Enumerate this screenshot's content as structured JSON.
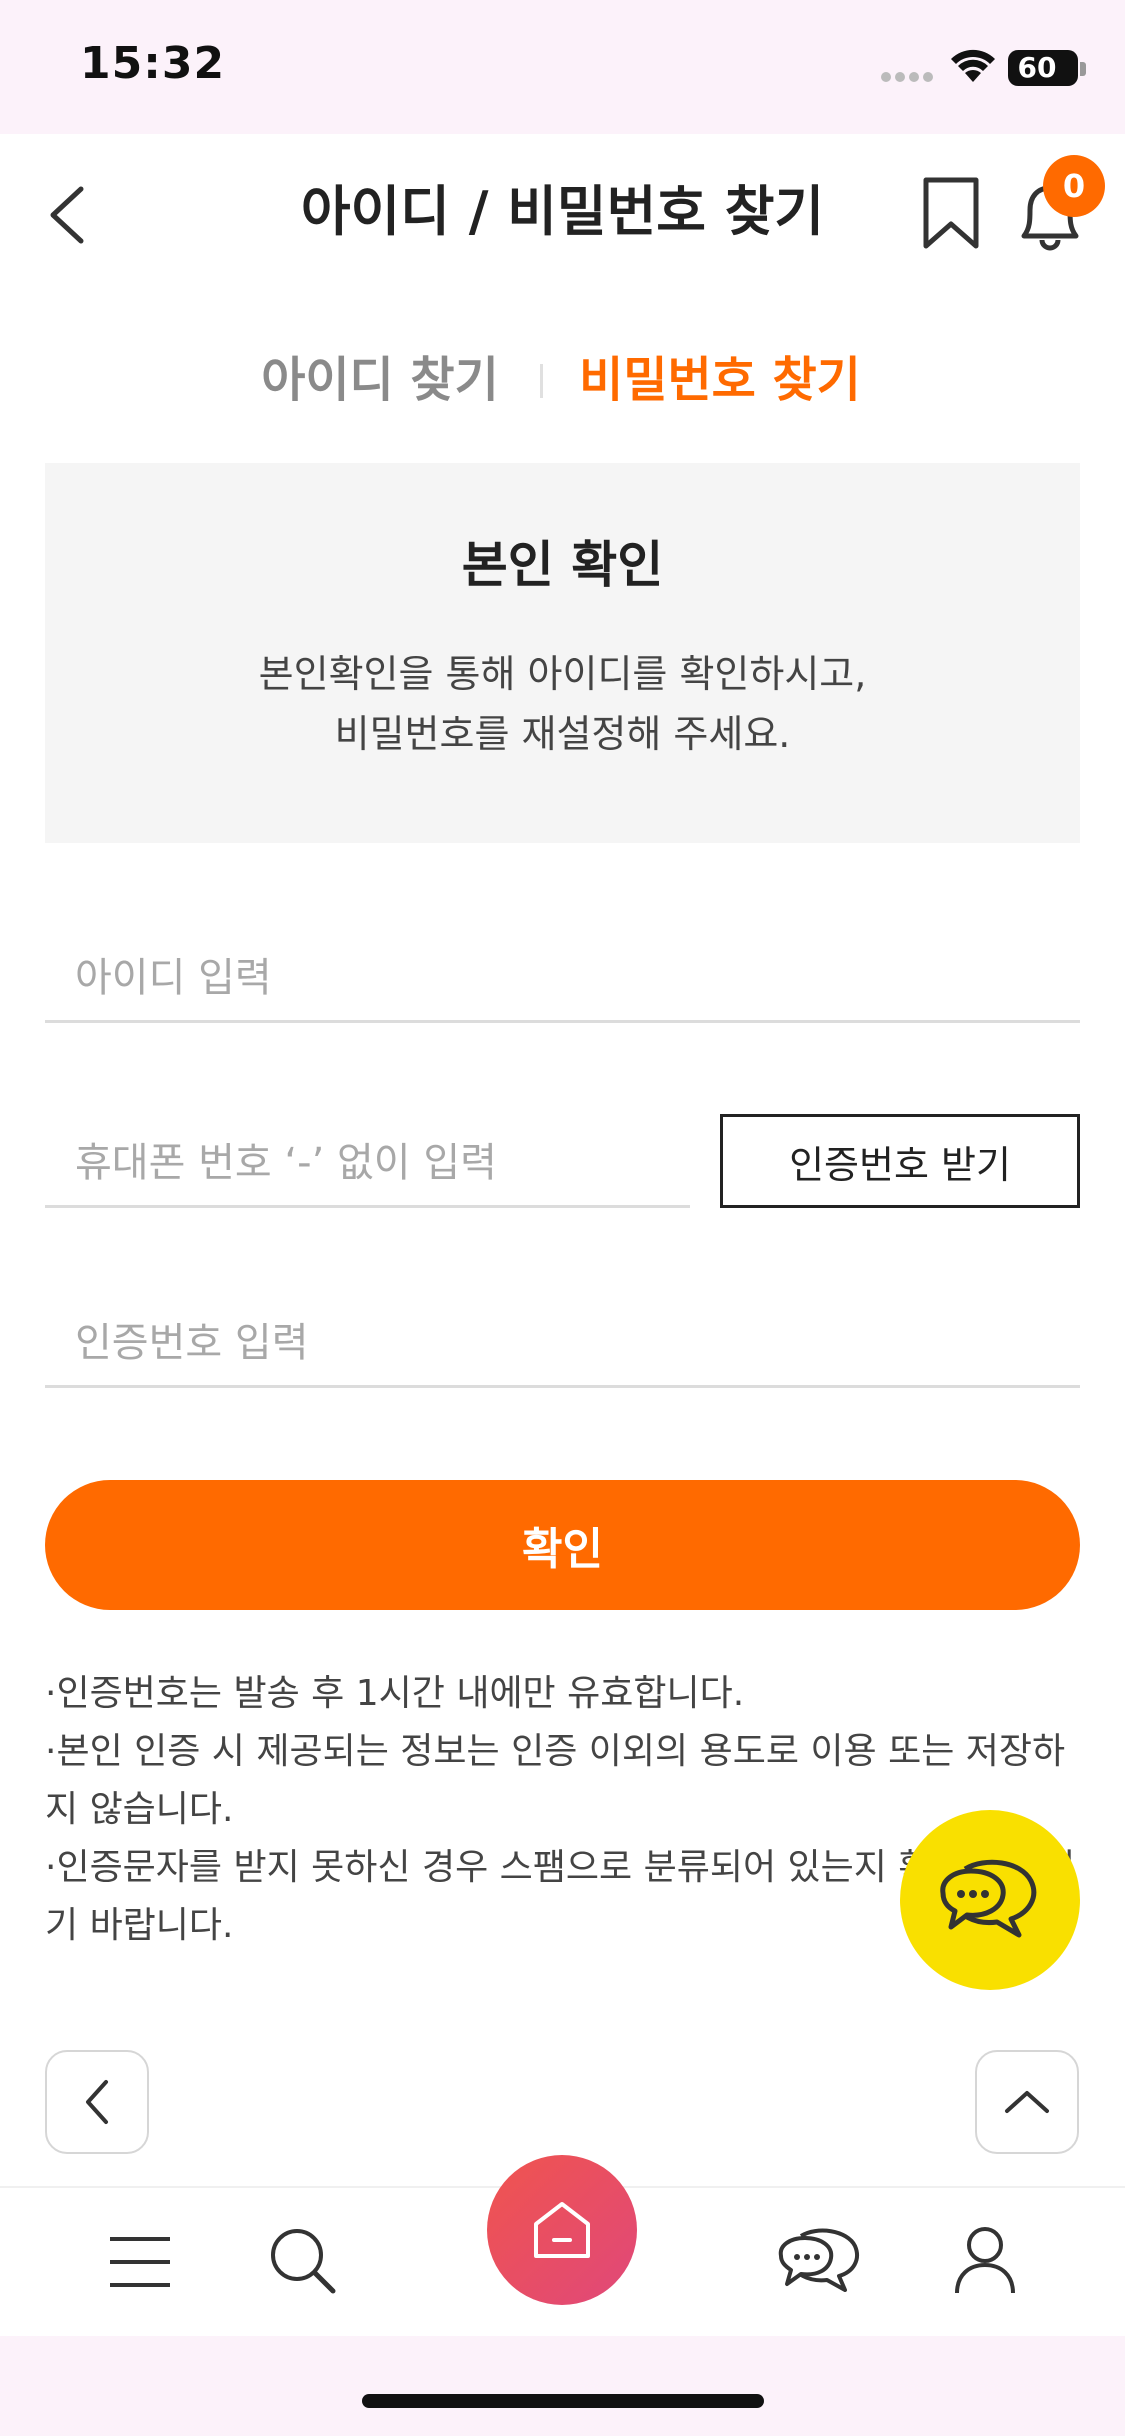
{
  "status_bar": {
    "time": "15:32",
    "battery": "60"
  },
  "header": {
    "title": "아이디 / 비밀번호 찾기",
    "notification_count": "0"
  },
  "tabs": [
    {
      "label": "아이디 찾기",
      "active": false
    },
    {
      "label": "비밀번호 찾기",
      "active": true
    }
  ],
  "info": {
    "title": "본인 확인",
    "desc_line1": "본인확인을 통해 아이디를 확인하시고,",
    "desc_line2": "비밀번호를 재설정해 주세요."
  },
  "form": {
    "id_placeholder": "아이디 입력",
    "phone_placeholder": "휴대폰 번호 ‘-’ 없이 입력",
    "get_code_label": "인증번호 받기",
    "code_placeholder": "인증번호 입력",
    "confirm_label": "확인"
  },
  "notes": [
    "·인증번호는 발송 후 1시간 내에만 유효합니다.",
    "·본인 인증 시 제공되는 정보는 인증 이외의 용도로 이용 또는 저장하지 않습니다.",
    "·인증문자를 받지 못하신 경우 스팸으로 분류되어 있는지 확인해 주시기 바랍니다."
  ],
  "colors": {
    "accent": "#ff6a00",
    "chat_fab": "#f9e000",
    "home_gradient_start": "#f0544e",
    "home_gradient_end": "#e0487a"
  }
}
